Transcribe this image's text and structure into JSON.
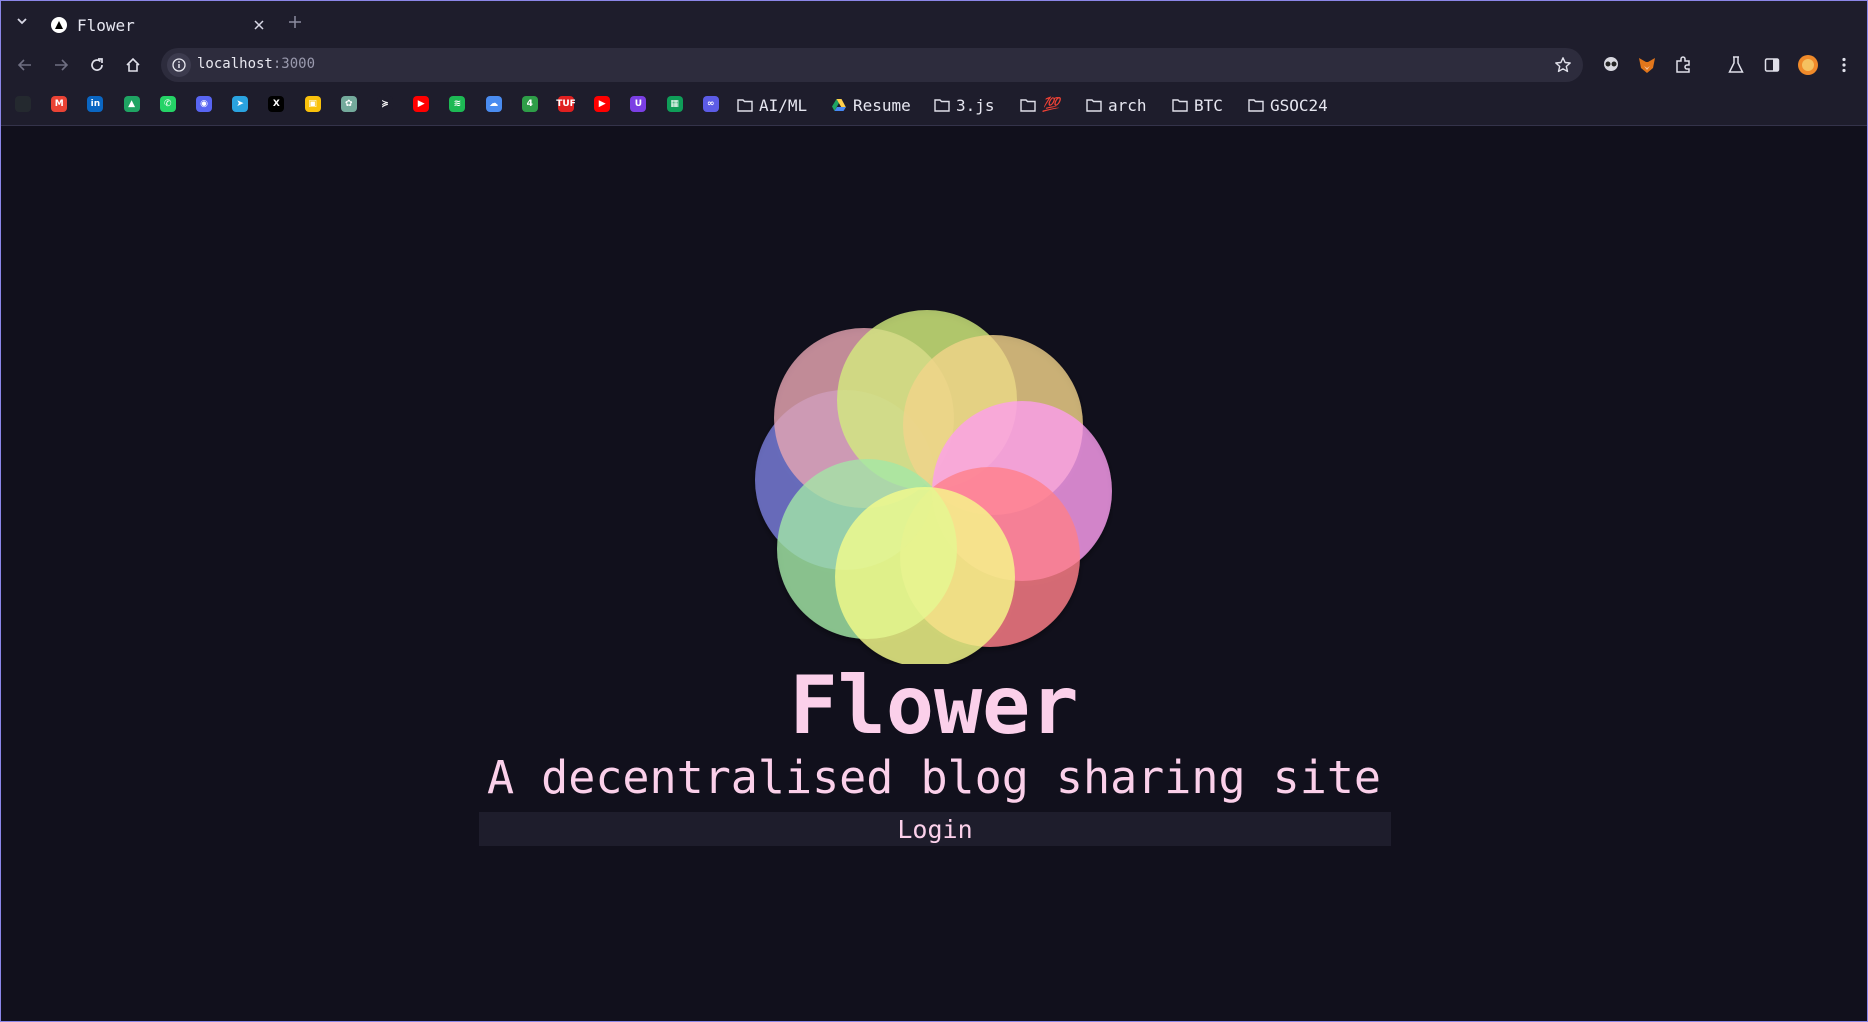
{
  "browser": {
    "tab": {
      "title": "Flower"
    },
    "address": {
      "host": "localhost",
      "port": ":3000"
    },
    "bookmarks": {
      "folders": [
        {
          "label": "AI/ML",
          "icon": "folder-icon"
        },
        {
          "label": "Resume",
          "icon": "google-drive-icon"
        },
        {
          "label": "3.js",
          "icon": "folder-icon"
        },
        {
          "label": "💯",
          "icon": "folder-icon"
        },
        {
          "label": "arch",
          "icon": "folder-icon"
        },
        {
          "label": "BTC",
          "icon": "folder-icon"
        },
        {
          "label": "GSOC24",
          "icon": "folder-icon"
        }
      ],
      "icons": [
        {
          "name": "github-icon",
          "color": "#24292f",
          "glyph": ""
        },
        {
          "name": "gmail-icon",
          "color": "#ea4335",
          "glyph": "M"
        },
        {
          "name": "linkedin-icon",
          "color": "#0a66c2",
          "glyph": "in"
        },
        {
          "name": "google-drive-icon",
          "color": "#1fa463",
          "glyph": "▲"
        },
        {
          "name": "whatsapp-icon",
          "color": "#25d366",
          "glyph": "✆"
        },
        {
          "name": "discord-icon",
          "color": "#5865f2",
          "glyph": "◉"
        },
        {
          "name": "telegram-icon",
          "color": "#2aa3e0",
          "glyph": "➤"
        },
        {
          "name": "x-icon",
          "color": "#000000",
          "glyph": "X"
        },
        {
          "name": "google-classroom-icon",
          "color": "#f9c10b",
          "glyph": "▣"
        },
        {
          "name": "chatgpt-icon",
          "color": "#74aa9c",
          "glyph": "✿"
        },
        {
          "name": "slashdev-icon",
          "color": "#1e1d2c",
          "glyph": "≽"
        },
        {
          "name": "youtube-music-icon",
          "color": "#ff0000",
          "glyph": "▶"
        },
        {
          "name": "spotify-icon",
          "color": "#1db954",
          "glyph": "≋"
        },
        {
          "name": "cloud-app-icon",
          "color": "#4a8cf0",
          "glyph": "☁"
        },
        {
          "name": "four-icon",
          "color": "#2e9e48",
          "glyph": "4"
        },
        {
          "name": "tuf-icon",
          "color": "#e02020",
          "glyph": "TUF"
        },
        {
          "name": "youtube-icon",
          "color": "#ff0000",
          "glyph": "▶"
        },
        {
          "name": "proton-icon",
          "color": "#7b3fe4",
          "glyph": "U"
        },
        {
          "name": "google-sheets-icon",
          "color": "#0f9d58",
          "glyph": "▦"
        },
        {
          "name": "visual-studio-icon",
          "color": "#5c5ce6",
          "glyph": "∞"
        }
      ]
    }
  },
  "page": {
    "title": "Flower",
    "tagline": "A decentralised blog sharing site",
    "login_label": "Login",
    "accent_color": "#fbd0ea",
    "background_color": "#11101c"
  },
  "logo": {
    "name": "flower-logo",
    "petals": [
      {
        "color": "#7b7fdc"
      },
      {
        "color": "#a3e8a6"
      },
      {
        "color": "#f6fc8a"
      },
      {
        "color": "#ff7f88"
      },
      {
        "color": "#fc9df0"
      },
      {
        "color": "#f2d48a"
      },
      {
        "color": "#d4ed7e"
      },
      {
        "color": "#e8a6b4"
      }
    ]
  }
}
